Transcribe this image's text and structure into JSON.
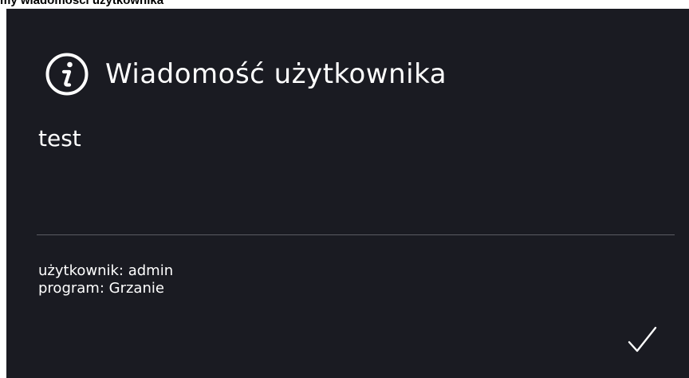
{
  "caption": "my wiadomości użytkownika",
  "dialog": {
    "icon": "info-icon",
    "title": "Wiadomość użytkownika",
    "message": "test",
    "meta": {
      "user": "użytkownik: admin",
      "program": "program: Grzanie"
    },
    "confirm_icon": "checkmark-icon"
  }
}
